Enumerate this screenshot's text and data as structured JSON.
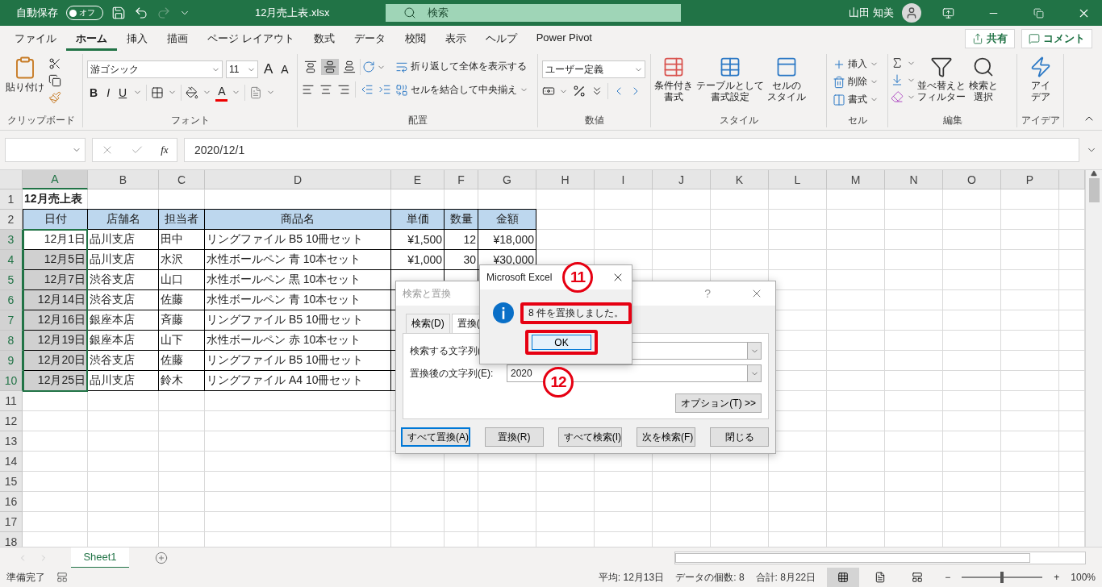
{
  "title_bar": {
    "autosave_label": "自動保存",
    "autosave_toggle": "オフ",
    "autosave_on": false,
    "file_name": "12月売上表.xlsx",
    "search_placeholder": "検索",
    "user_name": "山田 知美",
    "redo_disabled": true
  },
  "menu_tabs": [
    {
      "label": "ファイル",
      "selected": false
    },
    {
      "label": "ホーム",
      "selected": true
    },
    {
      "label": "挿入",
      "selected": false
    },
    {
      "label": "描画",
      "selected": false
    },
    {
      "label": "ページ レイアウト",
      "selected": false
    },
    {
      "label": "数式",
      "selected": false
    },
    {
      "label": "データ",
      "selected": false
    },
    {
      "label": "校閲",
      "selected": false
    },
    {
      "label": "表示",
      "selected": false
    },
    {
      "label": "ヘルプ",
      "selected": false
    },
    {
      "label": "Power Pivot",
      "selected": false
    }
  ],
  "share_button": "共有",
  "comment_button": "コメント",
  "ribbon": [
    {
      "kind": "clipboard",
      "label": "クリップボード",
      "paste": "貼り付け"
    },
    {
      "kind": "font",
      "label": "フォント",
      "font_name": "游ゴシック",
      "font_size": "11",
      "grow": "A",
      "shrink": "A",
      "styles": [
        "B",
        "I",
        "U"
      ],
      "font_color": "A"
    },
    {
      "kind": "alignment",
      "label": "配置",
      "vertical": [
        {
          "selected": false
        },
        {
          "selected": true
        },
        {
          "selected": false
        }
      ],
      "wrap": "折り返して全体を表示する",
      "merge": "セルを結合して中央揃え"
    },
    {
      "kind": "number",
      "label": "数値",
      "format": "ユーザー定義"
    },
    {
      "kind": "styles",
      "label": "スタイル",
      "buttons": [
        [
          "条件付き",
          "書式"
        ],
        [
          "テーブルとして",
          "書式設定"
        ],
        [
          "セルの",
          "スタイル"
        ]
      ]
    },
    {
      "kind": "cells",
      "label": "セル",
      "buttons": [
        "挿入",
        "削除",
        "書式"
      ]
    },
    {
      "kind": "editing",
      "label": "編集",
      "buttons": [
        [
          "並べ替えと",
          "フィルター"
        ],
        [
          "検索と",
          "選択"
        ]
      ]
    },
    {
      "kind": "ideas",
      "label": "アイデア",
      "buttons": [
        [
          "アイ",
          "デア"
        ]
      ]
    }
  ],
  "formula_bar": {
    "function_glyph": "fx",
    "value": "2020/12/1"
  },
  "sheet": {
    "columns": [
      {
        "label": "A",
        "selected": true
      },
      {
        "label": "B",
        "selected": false
      },
      {
        "label": "C",
        "selected": false
      },
      {
        "label": "D",
        "selected": false
      },
      {
        "label": "E",
        "selected": false
      },
      {
        "label": "F",
        "selected": false
      },
      {
        "label": "G",
        "selected": false
      },
      {
        "label": "H",
        "selected": false
      },
      {
        "label": "I",
        "selected": false
      },
      {
        "label": "J",
        "selected": false
      },
      {
        "label": "K",
        "selected": false
      },
      {
        "label": "L",
        "selected": false
      },
      {
        "label": "M",
        "selected": false
      },
      {
        "label": "N",
        "selected": false
      },
      {
        "label": "O",
        "selected": false
      },
      {
        "label": "P",
        "selected": false
      }
    ],
    "rows": [
      {
        "number": "1",
        "kind": "title",
        "selected": false,
        "cells": [
          "12月売上表"
        ]
      },
      {
        "number": "2",
        "kind": "header",
        "selected": false,
        "cells": [
          "日付",
          "店舗名",
          "担当者",
          "商品名",
          "単価",
          "数量",
          "金額"
        ]
      },
      {
        "number": "3",
        "kind": "data",
        "selected": true,
        "cells": [
          "12月1日",
          "品川支店",
          "田中",
          "リングファイル B5 10冊セット",
          "¥1,500",
          "12",
          "¥18,000"
        ]
      },
      {
        "number": "4",
        "kind": "data",
        "selected": true,
        "cells": [
          "12月5日",
          "品川支店",
          "水沢",
          "水性ボールペン 青 10本セット",
          "¥1,000",
          "30",
          "¥30,000"
        ]
      },
      {
        "number": "5",
        "kind": "data",
        "selected": true,
        "cells": [
          "12月7日",
          "渋谷支店",
          "山口",
          "水性ボールペン 黒 10本セット"
        ]
      },
      {
        "number": "6",
        "kind": "data",
        "selected": true,
        "cells": [
          "12月14日",
          "渋谷支店",
          "佐藤",
          "水性ボールペン 青 10本セット"
        ]
      },
      {
        "number": "7",
        "kind": "data",
        "selected": true,
        "cells": [
          "12月16日",
          "銀座本店",
          "斉藤",
          "リングファイル B5 10冊セット"
        ]
      },
      {
        "number": "8",
        "kind": "data",
        "selected": true,
        "cells": [
          "12月19日",
          "銀座本店",
          "山下",
          "水性ボールペン 赤 10本セット"
        ]
      },
      {
        "number": "9",
        "kind": "data",
        "selected": true,
        "cells": [
          "12月20日",
          "渋谷支店",
          "佐藤",
          "リングファイル B5 10冊セット"
        ]
      },
      {
        "number": "10",
        "kind": "data",
        "selected": true,
        "cells": [
          "12月25日",
          "品川支店",
          "鈴木",
          "リングファイル A4 10冊セット"
        ]
      },
      {
        "number": "11",
        "kind": "empty",
        "selected": false,
        "cells": []
      },
      {
        "number": "12",
        "kind": "empty",
        "selected": false,
        "cells": []
      },
      {
        "number": "13",
        "kind": "empty",
        "selected": false,
        "cells": []
      },
      {
        "number": "14",
        "kind": "empty",
        "selected": false,
        "cells": []
      },
      {
        "number": "15",
        "kind": "empty",
        "selected": false,
        "cells": []
      },
      {
        "number": "16",
        "kind": "empty",
        "selected": false,
        "cells": []
      },
      {
        "number": "17",
        "kind": "empty",
        "selected": false,
        "cells": []
      },
      {
        "number": "18",
        "kind": "empty",
        "selected": false,
        "cells": []
      }
    ]
  },
  "find_replace_dialog": {
    "title": "検索と置換",
    "help": "?",
    "tabs": [
      {
        "label": "検索(D)",
        "selected": false
      },
      {
        "label": "置換(",
        "selected": true
      }
    ],
    "find_label": "検索する文字列(",
    "replace_label": "置換後の文字列(E):",
    "replace_value": "2020",
    "options_button": "オプション(T) >>",
    "buttons": [
      {
        "label": "すべて置換(A)",
        "selected": true
      },
      {
        "label": "置換(R)",
        "selected": false
      },
      {
        "label": "すべて検索(I)",
        "selected": false
      },
      {
        "label": "次を検索(F)",
        "selected": false
      },
      {
        "label": "閉じる",
        "selected": false
      }
    ]
  },
  "message_box": {
    "title": "Microsoft Excel",
    "message": "8 件を置換しました。",
    "ok_button": "OK"
  },
  "annotations": [
    "11",
    "12"
  ],
  "sheet_tabs": [
    {
      "label": "Sheet1",
      "selected": true
    }
  ],
  "status_bar": {
    "status": "準備完了",
    "average": "平均: 12月13日",
    "count": "データの個数: 8",
    "sum": "合計: 8月22日",
    "views": [
      {
        "selected": true
      },
      {
        "selected": false
      },
      {
        "selected": false
      }
    ],
    "zoom_out": "−",
    "zoom_in": "+",
    "zoom": {
      "level": 0.5
    },
    "zoom_text": "100%"
  }
}
